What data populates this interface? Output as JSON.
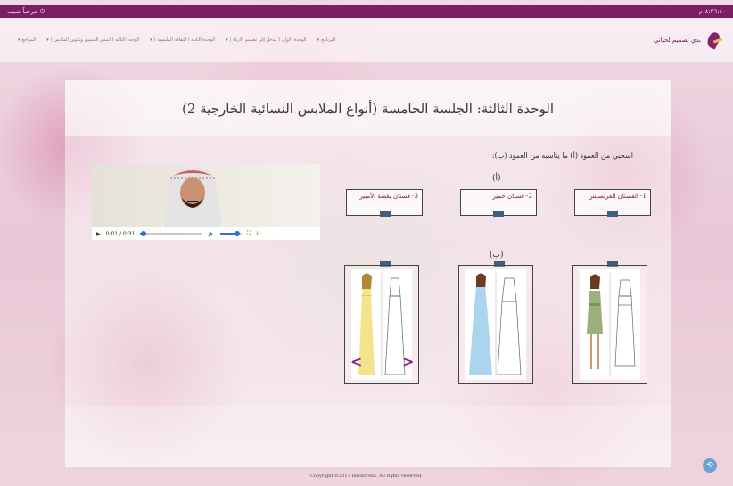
{
  "topbar": {
    "user_label": "مرحباً ضيف",
    "time": "٨:٢٦:٤٠ م"
  },
  "navbar": {
    "logo_text": "بدي تصميم لحياتي",
    "menu": [
      {
        "label": "البرنامج"
      },
      {
        "label": "الوحدة الأولى ( مدخل إلى تصميم الأزياء )"
      },
      {
        "label": "الوحدة الثانية ( الثقافة الملبسية )"
      },
      {
        "label": "الوحدة الثالثة ( أسس التنسيق وتكوين الملابس )"
      },
      {
        "label": "المراجع"
      }
    ]
  },
  "page": {
    "title": "الوحدة الثالثة: الجلسة الخامسة (أنواع الملابس النسائية الخارجية 2)",
    "instruction": "اسحبي من العمود (أ) ما يناسبه من العمود (ب):",
    "col_a_label": "(أ)",
    "col_b_label": "(ب)",
    "answers": [
      {
        "text": "1- الفستان الفرنسيس"
      },
      {
        "text": "2- فستان حمير"
      },
      {
        "text": "3- فستان بقصة الأمبير"
      }
    ]
  },
  "video": {
    "time": "0:01 / 0:31",
    "progress": 0.05,
    "volume": 0.8
  },
  "footer": {
    "copyright": "Copyright ©2017 DevBorens. All rights reserved."
  },
  "colors": {
    "brand": "#7a1f63",
    "arrow": "#8a1f83",
    "tab": "#3f5f7a",
    "dress_green": "#9bb07a",
    "dress_blue": "#aad4ef",
    "dress_yellow": "#f3e38a"
  }
}
